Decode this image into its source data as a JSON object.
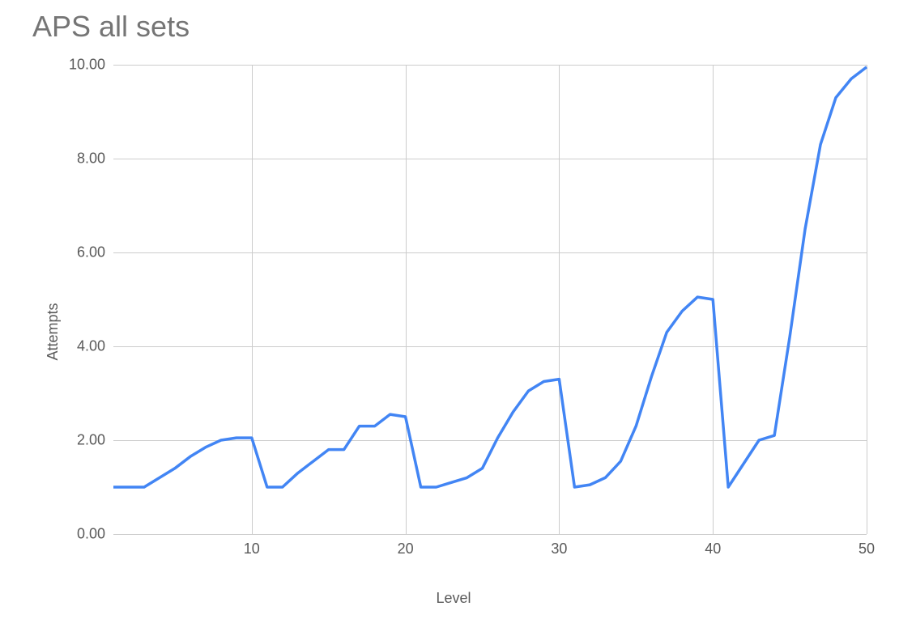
{
  "chart_data": {
    "type": "line",
    "title": "APS all sets",
    "xlabel": "Level",
    "ylabel": "Attempts",
    "xlim": [
      1,
      50
    ],
    "ylim": [
      0,
      10
    ],
    "xticks": [
      10,
      20,
      30,
      40,
      50
    ],
    "yticks": [
      0.0,
      2.0,
      4.0,
      6.0,
      8.0,
      10.0
    ],
    "x": [
      1,
      2,
      3,
      4,
      5,
      6,
      7,
      8,
      9,
      10,
      11,
      12,
      13,
      14,
      15,
      16,
      17,
      18,
      19,
      20,
      21,
      22,
      23,
      24,
      25,
      26,
      27,
      28,
      29,
      30,
      31,
      32,
      33,
      34,
      35,
      36,
      37,
      38,
      39,
      40,
      41,
      42,
      43,
      44,
      45,
      46,
      47,
      48,
      49,
      50
    ],
    "values": [
      1.0,
      1.0,
      1.0,
      1.2,
      1.4,
      1.65,
      1.85,
      2.0,
      2.05,
      2.05,
      1.0,
      1.0,
      1.3,
      1.55,
      1.8,
      1.8,
      2.3,
      2.3,
      2.55,
      2.5,
      1.0,
      1.0,
      1.1,
      1.2,
      1.4,
      2.05,
      2.6,
      3.05,
      3.25,
      3.3,
      1.0,
      1.05,
      1.2,
      1.55,
      2.3,
      3.35,
      4.3,
      4.75,
      5.05,
      5.0,
      1.0,
      1.5,
      2.0,
      2.1,
      4.2,
      6.5,
      8.3,
      9.3,
      9.7,
      9.95
    ],
    "line_color": "#4285f4",
    "grid": true
  }
}
